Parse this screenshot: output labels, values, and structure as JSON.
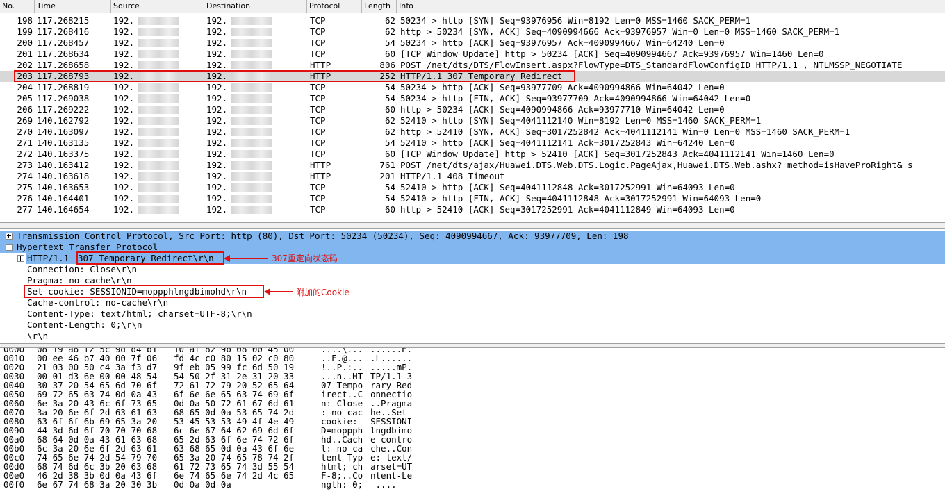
{
  "packet_list": {
    "columns": [
      "No.",
      "Time",
      "Source",
      "Destination",
      "Protocol",
      "Length",
      "Info"
    ],
    "rows": [
      {
        "no": "198",
        "time": "117.268215",
        "src": "192.",
        "dst": "192.",
        "proto": "TCP",
        "len": "62",
        "info": "50234 > http [SYN] Seq=93976956 Win=8192 Len=0 MSS=1460 SACK_PERM=1"
      },
      {
        "no": "199",
        "time": "117.268416",
        "src": "192.",
        "dst": "192.",
        "proto": "TCP",
        "len": "62",
        "info": "http > 50234 [SYN, ACK] Seq=4090994666 Ack=93976957 Win=0 Len=0 MSS=1460 SACK_PERM=1"
      },
      {
        "no": "200",
        "time": "117.268457",
        "src": "192.",
        "dst": "192.",
        "proto": "TCP",
        "len": "54",
        "info": "50234 > http [ACK] Seq=93976957 Ack=4090994667 Win=64240 Len=0"
      },
      {
        "no": "201",
        "time": "117.268634",
        "src": "192.",
        "dst": "192.",
        "proto": "TCP",
        "len": "60",
        "info": "[TCP Window Update] http > 50234 [ACK] Seq=4090994667 Ack=93976957 Win=1460 Len=0"
      },
      {
        "no": "202",
        "time": "117.268658",
        "src": "192.",
        "dst": "192.",
        "proto": "HTTP",
        "len": "806",
        "info": "POST /net/dts/DTS/FlowInsert.aspx?FlowType=DTS_StandardFlowConfigID HTTP/1.1 , NTLMSSP_NEGOTIATE"
      },
      {
        "no": "203",
        "time": "117.268793",
        "src": "192.",
        "dst": "192.",
        "proto": "HTTP",
        "len": "252",
        "info": "HTTP/1.1 307 Temporary Redirect"
      },
      {
        "no": "204",
        "time": "117.268819",
        "src": "192.",
        "dst": "192.",
        "proto": "TCP",
        "len": "54",
        "info": "50234 > http [ACK] Seq=93977709 Ack=4090994866 Win=64042 Len=0"
      },
      {
        "no": "205",
        "time": "117.269038",
        "src": "192.",
        "dst": "192.",
        "proto": "TCP",
        "len": "54",
        "info": "50234 > http [FIN, ACK] Seq=93977709 Ack=4090994866 Win=64042 Len=0"
      },
      {
        "no": "206",
        "time": "117.269222",
        "src": "192.",
        "dst": "192.",
        "proto": "TCP",
        "len": "60",
        "info": "http > 50234 [ACK] Seq=4090994866 Ack=93977710 Win=64042 Len=0"
      },
      {
        "no": "269",
        "time": "140.162792",
        "src": "192.",
        "dst": "192.",
        "proto": "TCP",
        "len": "62",
        "info": "52410 > http [SYN] Seq=4041112140 Win=8192 Len=0 MSS=1460 SACK_PERM=1"
      },
      {
        "no": "270",
        "time": "140.163097",
        "src": "192.",
        "dst": "192.",
        "proto": "TCP",
        "len": "62",
        "info": "http > 52410 [SYN, ACK] Seq=3017252842 Ack=4041112141 Win=0 Len=0 MSS=1460 SACK_PERM=1"
      },
      {
        "no": "271",
        "time": "140.163135",
        "src": "192.",
        "dst": "192.",
        "proto": "TCP",
        "len": "54",
        "info": "52410 > http [ACK] Seq=4041112141 Ack=3017252843 Win=64240 Len=0"
      },
      {
        "no": "272",
        "time": "140.163375",
        "src": "192.",
        "dst": "192.",
        "proto": "TCP",
        "len": "60",
        "info": "[TCP Window Update] http > 52410 [ACK] Seq=3017252843 Ack=4041112141 Win=1460 Len=0"
      },
      {
        "no": "273",
        "time": "140.163412",
        "src": "192.",
        "dst": "192.",
        "proto": "HTTP",
        "len": "761",
        "info": "POST /net/dts/ajax/Huawei.DTS.Web.DTS.Logic.PageAjax,Huawei.DTS.Web.ashx?_method=isHaveProRight&_s"
      },
      {
        "no": "274",
        "time": "140.163618",
        "src": "192.",
        "dst": "192.",
        "proto": "HTTP",
        "len": "201",
        "info": "HTTP/1.1 408 Timeout"
      },
      {
        "no": "275",
        "time": "140.163653",
        "src": "192.",
        "dst": "192.",
        "proto": "TCP",
        "len": "54",
        "info": "52410 > http [ACK] Seq=4041112848 Ack=3017252991 Win=64093 Len=0"
      },
      {
        "no": "276",
        "time": "140.164401",
        "src": "192.",
        "dst": "192.",
        "proto": "TCP",
        "len": "54",
        "info": "52410 > http [FIN, ACK] Seq=4041112848 Ack=3017252991 Win=64093 Len=0"
      },
      {
        "no": "277",
        "time": "140.164654",
        "src": "192.",
        "dst": "192.",
        "proto": "TCP",
        "len": "60",
        "info": "http > 52410 [ACK] Seq=3017252991 Ack=4041112849 Win=64093 Len=0"
      }
    ]
  },
  "details": {
    "tcp": "Transmission Control Protocol, Src Port: http (80), Dst Port: 50234 (50234), Seq: 4090994667, Ack: 93977709, Len: 198",
    "http": "Hypertext Transfer Protocol",
    "status_prefix": "HTTP/1.1 ",
    "status_text": "307 Temporary Redirect\\r\\n",
    "connection": "Connection: Close\\r\\n",
    "pragma": "Pragma: no-cache\\r\\n",
    "set_cookie": "Set-cookie: SESSIONID=moppphlngdbimohd\\r\\n",
    "cache_control": "Cache-control: no-cache\\r\\n",
    "content_type": "Content-Type: text/html; charset=UTF-8;\\r\\n",
    "content_length": "Content-Length: 0;\\r\\n",
    "crlf": "\\r\\n"
  },
  "annotations": {
    "status_note": "307重定向状态码",
    "cookie_note": "附加的Cookie"
  },
  "hex_dump": [
    {
      "off": "0000",
      "b1": "08 19 a6 f2 5c 9d d4 b1",
      "b2": "10 af 82 9b 08 00 45 00",
      "a1": "....\\...",
      "a2": "......E."
    },
    {
      "off": "0010",
      "b1": "00 ee 46 b7 40 00 7f 06",
      "b2": "fd 4c c0 80 15 02 c0 80",
      "a1": "..F.@...",
      "a2": ".L......"
    },
    {
      "off": "0020",
      "b1": "21 03 00 50 c4 3a f3 d7",
      "b2": "9f eb 05 99 fc 6d 50 19",
      "a1": "!..P.:..",
      "a2": ".....mP."
    },
    {
      "off": "0030",
      "b1": "00 01 d3 6e 00 00 48 54",
      "b2": "54 50 2f 31 2e 31 20 33",
      "a1": "...n..HT",
      "a2": "TP/1.1 3"
    },
    {
      "off": "0040",
      "b1": "30 37 20 54 65 6d 70 6f",
      "b2": "72 61 72 79 20 52 65 64",
      "a1": "07 Tempo",
      "a2": "rary Red"
    },
    {
      "off": "0050",
      "b1": "69 72 65 63 74 0d 0a 43",
      "b2": "6f 6e 6e 65 63 74 69 6f",
      "a1": "irect..C",
      "a2": "onnectio"
    },
    {
      "off": "0060",
      "b1": "6e 3a 20 43 6c 6f 73 65",
      "b2": "0d 0a 50 72 61 67 6d 61",
      "a1": "n: Close",
      "a2": "..Pragma"
    },
    {
      "off": "0070",
      "b1": "3a 20 6e 6f 2d 63 61 63",
      "b2": "68 65 0d 0a 53 65 74 2d",
      "a1": ": no-cac",
      "a2": "he..Set-"
    },
    {
      "off": "0080",
      "b1": "63 6f 6f 6b 69 65 3a 20",
      "b2": "53 45 53 53 49 4f 4e 49",
      "a1": "cookie: ",
      "a2": "SESSIONI"
    },
    {
      "off": "0090",
      "b1": "44 3d 6d 6f 70 70 70 68",
      "b2": "6c 6e 67 64 62 69 6d 6f",
      "a1": "D=moppph",
      "a2": "lngdbimo"
    },
    {
      "off": "00a0",
      "b1": "68 64 0d 0a 43 61 63 68",
      "b2": "65 2d 63 6f 6e 74 72 6f",
      "a1": "hd..Cach",
      "a2": "e-contro"
    },
    {
      "off": "00b0",
      "b1": "6c 3a 20 6e 6f 2d 63 61",
      "b2": "63 68 65 0d 0a 43 6f 6e",
      "a1": "l: no-ca",
      "a2": "che..Con"
    },
    {
      "off": "00c0",
      "b1": "74 65 6e 74 2d 54 79 70",
      "b2": "65 3a 20 74 65 78 74 2f",
      "a1": "tent-Typ",
      "a2": "e: text/"
    },
    {
      "off": "00d0",
      "b1": "68 74 6d 6c 3b 20 63 68",
      "b2": "61 72 73 65 74 3d 55 54",
      "a1": "html; ch",
      "a2": "arset=UT"
    },
    {
      "off": "00e0",
      "b1": "46 2d 38 3b 0d 0a 43 6f",
      "b2": "6e 74 65 6e 74 2d 4c 65",
      "a1": "F-8;..Co",
      "a2": "ntent-Le"
    },
    {
      "off": "00f0",
      "b1": "6e 67 74 68 3a 20 30 3b",
      "b2": "0d 0a 0d 0a",
      "a1": "ngth: 0;",
      "a2": " ...."
    }
  ],
  "colors": {
    "highlight": "#81b6ef",
    "selected_row": "#d8d8d8",
    "annotation": "#e01010"
  }
}
